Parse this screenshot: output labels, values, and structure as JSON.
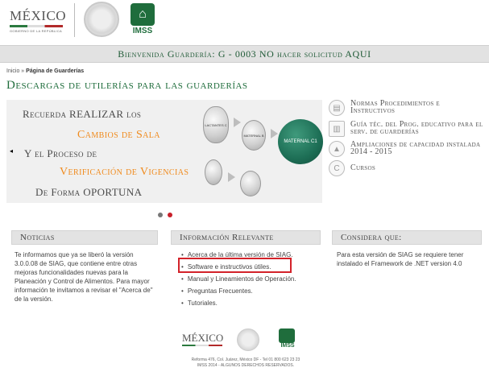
{
  "header": {
    "gov_logo_word": "MÉXICO",
    "gov_logo_sub": "GOBIERNO DE LA REPÚBLICA",
    "imss_logo_text": "IMSS"
  },
  "welcome": "Bienvenida Guardería: G - 0003 NO hacer solicitud AQUI",
  "breadcrumb": {
    "home": "Inicio",
    "sep": "»",
    "current": "Página de Guarderías"
  },
  "page_title": "Descargas de utilerías para las guarderías",
  "banner": {
    "line1": "Recuerda REALIZAR los",
    "line2": "Cambios de Sala",
    "line3": "Y el Proceso de",
    "line4": "Verificación de Vigencias",
    "line5": "De Forma OPORTUNA",
    "circle_lactantes": "LACTANTES C",
    "circle_maternal_b": "MATERNAL B",
    "circle_maternal_c1": "MATERNAL C1",
    "circle_small_a": "",
    "circle_small_b": "",
    "prev_glyph": "◂"
  },
  "right_links": [
    {
      "label": "Normas Procedimientos e Instructivos",
      "icon": "book-icon"
    },
    {
      "label": "Guía téc. del Prog. educativo para el serv. de guarderías",
      "icon": "document-icon"
    },
    {
      "label": "Ampliaciones de capacidad instalada 2014 - 2015",
      "icon": "triangle-icon"
    },
    {
      "label": "Cursos",
      "icon": "c-icon"
    }
  ],
  "noticias": {
    "title": "Noticias",
    "body": "Te informamos que ya se liberó la versión 3.0.0.08 de SIAG, que contiene entre otras mejoras funcionalidades nuevas para la Planeación y Control de Alimentos. Para mayor información te invitamos a revisar el \"Acerca de\" de la versión."
  },
  "info": {
    "title": "Información Relevante",
    "items": [
      "Acerca de la última versión de SIAG.",
      "Software e instructivos útiles.",
      "Manual y Lineamientos de Operación.",
      "Preguntas Frecuentes.",
      "Tutoriales."
    ]
  },
  "considera": {
    "title": "Considera que:",
    "body": "Para esta versión de SIAG se requiere tener instalado el Framework de .NET version 4.0"
  },
  "footer": {
    "address": "Reforma 476, Col. Juárez, México DF - Tel 01 800 623 23 23",
    "rights": "IMSS 2014 - ALGUNOS DERECHOS RESERVADOS."
  },
  "colors": {
    "accent_green": "#1f6d3c",
    "orange": "#f08a1c",
    "highlight_red": "#d3222a"
  }
}
